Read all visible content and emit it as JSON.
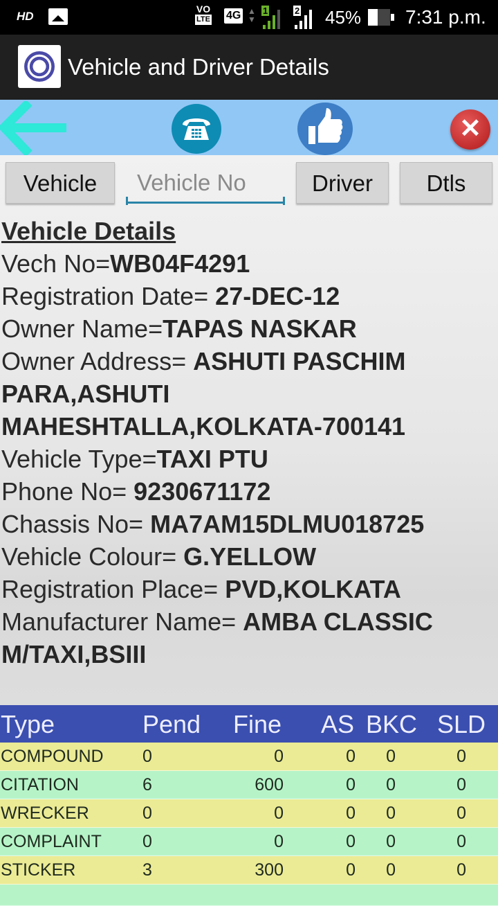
{
  "status_bar": {
    "hd": "HD",
    "volte_top": "VO",
    "volte_bottom": "LTE",
    "network": "4G",
    "sim1": "1",
    "sim2": "2",
    "battery": "45%",
    "battery_level": 0.45,
    "time": "7:31 p.m."
  },
  "app_bar": {
    "title": "Vehicle and Driver Details"
  },
  "toolbar": {
    "back_icon": "arrow-left-icon",
    "phone_icon": "telephone-icon",
    "like_icon": "thumbs-up-icon",
    "close_icon": "close-icon",
    "close_glyph": "✕"
  },
  "search": {
    "vehicle_label": "Vehicle",
    "input_placeholder": "Vehicle No",
    "input_value": "",
    "driver_label": "Driver",
    "dtls_label": "Dtls"
  },
  "details": {
    "heading": "Vehicle Details",
    "fields": [
      {
        "label": "Vech No=",
        "value": "WB04F4291"
      },
      {
        "label": "Registration Date= ",
        "value": "27-DEC-12"
      },
      {
        "label": "Owner Name=",
        "value": "TAPAS NASKAR"
      },
      {
        "label": "Owner Address= ",
        "value": "ASHUTI PASCHIM PARA,ASHUTI MAHESHTALLA,KOLKATA-700141"
      },
      {
        "label": "Vehicle Type=",
        "value": "TAXI PTU"
      },
      {
        "label": "Phone No= ",
        "value": "9230671172"
      },
      {
        "label": "Chassis No= ",
        "value": "MA7AM15DLMU018725"
      },
      {
        "label": "Vehicle Colour= ",
        "value": "G.YELLOW"
      },
      {
        "label": "Registration Place= ",
        "value": "PVD,KOLKATA"
      },
      {
        "label": "Manufacturer Name= ",
        "value": "AMBA CLASSIC M/TAXI,BSIII"
      }
    ]
  },
  "offences": {
    "headers": [
      "Type",
      "Pend",
      "Fine",
      "AS",
      "BKC",
      "SLD"
    ],
    "rows": [
      [
        "COMPOUND",
        "0",
        "0",
        "0",
        "0",
        "0"
      ],
      [
        "CITATION",
        "6",
        "600",
        "0",
        "0",
        "0"
      ],
      [
        "WRECKER",
        "0",
        "0",
        "0",
        "0",
        "0"
      ],
      [
        "COMPLAINT",
        "0",
        "0",
        "0",
        "0",
        "0"
      ],
      [
        "STICKER",
        "3",
        "300",
        "0",
        "0",
        "0"
      ]
    ]
  },
  "colors": {
    "toolbar_bg": "#91c7f5",
    "table_header": "#3b4fb0",
    "row_yellow": "#ebeb95",
    "row_green": "#b6f4c8",
    "back_arrow": "#2ee8d8"
  }
}
